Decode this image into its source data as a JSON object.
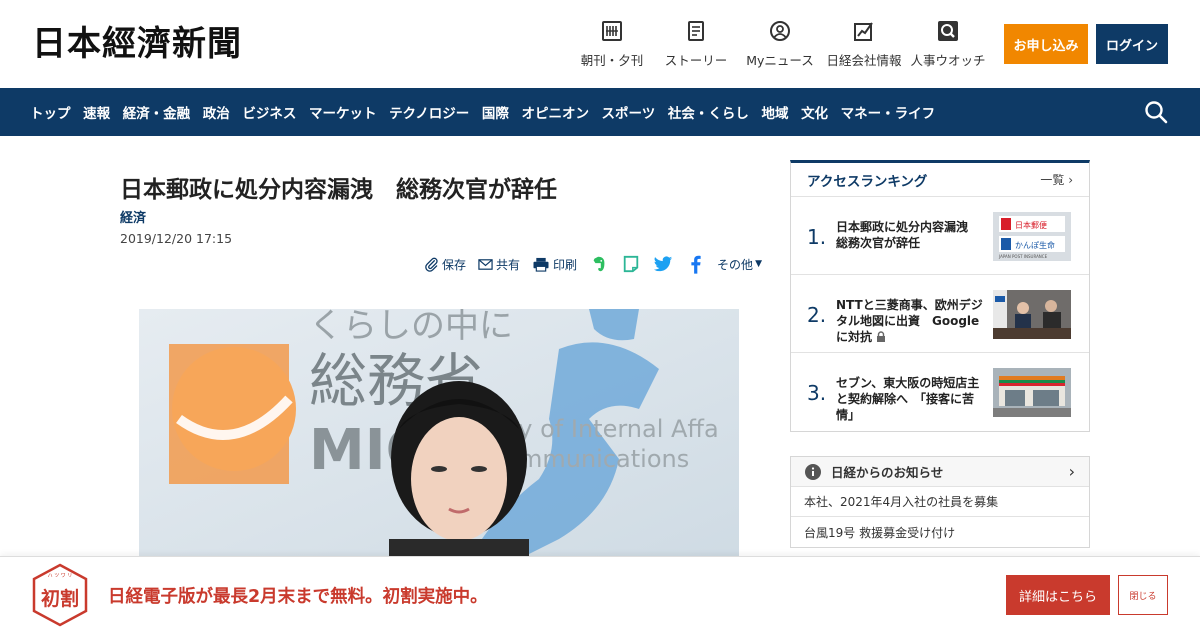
{
  "header": {
    "logo": "日本經濟新聞",
    "nav": [
      {
        "label": "朝刊・夕刊",
        "icon": "newspaper-icon"
      },
      {
        "label": "ストーリー",
        "icon": "story-icon"
      },
      {
        "label": "Myニュース",
        "icon": "my-news-icon"
      },
      {
        "label": "日経会社情報",
        "icon": "company-info-icon"
      },
      {
        "label": "人事ウオッチ",
        "icon": "personnel-watch-icon"
      }
    ],
    "apply_label": "お申し込み",
    "login_label": "ログイン"
  },
  "navbar": {
    "items": [
      "トップ",
      "速報",
      "経済・金融",
      "政治",
      "ビジネス",
      "マーケット",
      "テクノロジー",
      "国際",
      "オピニオン",
      "スポーツ",
      "社会・くらし",
      "地域",
      "文化",
      "マネー・ライフ"
    ]
  },
  "article": {
    "title": "日本郵政に処分内容漏洩　総務次官が辞任",
    "category": "経済",
    "date": "2019/12/20 17:15",
    "share": {
      "save": "保存",
      "share": "共有",
      "print": "印刷",
      "more": "その他"
    },
    "photo": {
      "sign_top": "くらしの中に",
      "sign_main": "総務省",
      "sign_logo": "MIC",
      "sign_en1": "try of Internal Affa",
      "sign_en2": "mmunications"
    }
  },
  "ranking": {
    "title": "アクセスランキング",
    "all_label": "一覧",
    "items": [
      {
        "num": "1.",
        "text": "日本郵政に処分内容漏洩　総務次官が辞任",
        "thumb_text1": "日本郵便",
        "thumb_text2": "かんぽ生命",
        "thumb_text3": "JAPAN POST INSURANCE"
      },
      {
        "num": "2.",
        "text": "NTTと三菱商事、欧州デジタル地図に出資　Googleに対抗"
      },
      {
        "num": "3.",
        "text": "セブン、東大阪の時短店主と契約解除へ　「接客に苦情」"
      }
    ]
  },
  "notice": {
    "title": "日経からのお知らせ",
    "items": [
      "本社、2021年4月入社の社員を募集",
      "台風19号 救援募金受け付け"
    ]
  },
  "promo": {
    "text": "日経電子版が最長2月末まで無料。初割実施中。",
    "badge_text": "初割",
    "badge_ruby": "ハ ツ ワ リ",
    "detail_label": "詳細はこちら",
    "close_label": "閉じる"
  },
  "colors": {
    "navy": "#0e3a66",
    "orange": "#f18700",
    "red": "#c93a2d"
  }
}
